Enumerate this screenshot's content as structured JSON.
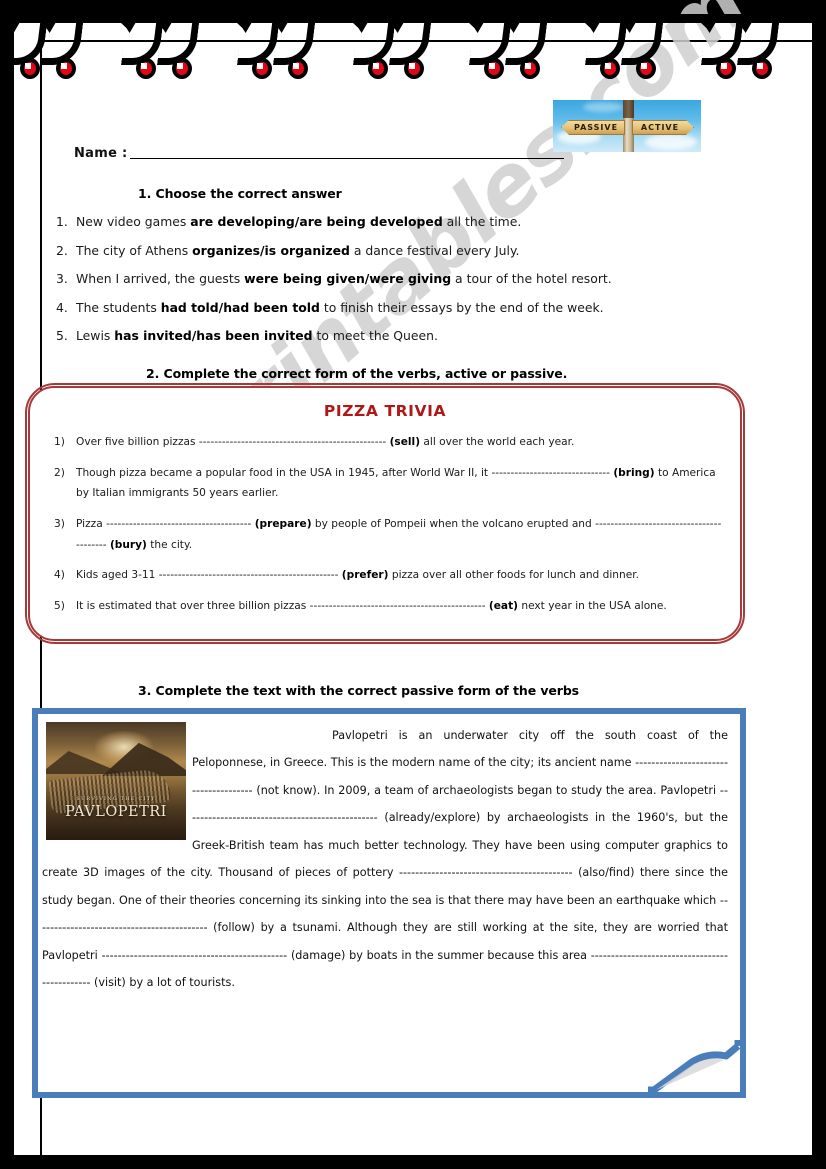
{
  "watermark": {
    "text": "ESLprintables.com"
  },
  "header": {
    "name_label": "Name :",
    "signpost": {
      "left_label": "PASSIVE",
      "right_label": "ACTIVE"
    }
  },
  "exercise1": {
    "heading": "1.   Choose the correct answer",
    "items": [
      {
        "num": "1.",
        "pre": "New video games ",
        "bold": "are developing/are being developed",
        "post": " all the time."
      },
      {
        "num": "2.",
        "pre": "The city of Athens ",
        "bold": "organizes/is organized",
        "post": " a dance festival every July."
      },
      {
        "num": "3.",
        "pre": "When I arrived, the guests ",
        "bold": "were being given/were giving",
        "post": " a tour of the hotel resort."
      },
      {
        "num": "4.",
        "pre": "The students ",
        "bold": "had told/had been told",
        "post": " to finish their essays by the end of the week."
      },
      {
        "num": "5.",
        "pre": "Lewis ",
        "bold": "has invited/has been invited",
        "post": " to meet the Queen."
      }
    ]
  },
  "exercise2": {
    "heading": "2.   Complete the correct form of the verbs, active or passive.",
    "box_title": "PIZZA TRIVIA",
    "items": [
      {
        "num": "1)",
        "pre": "Over five billion pizzas ------------------------------------------------- ",
        "bold": "(sell)",
        "post": " all over the world each year."
      },
      {
        "num": "2)",
        "pre": "Though pizza became a popular food in the USA in 1945, after World War II, it ------------------------------- ",
        "bold": "(bring)",
        "post": " to America by Italian immigrants 50 years earlier."
      },
      {
        "num": "3)",
        "pre": "Pizza -------------------------------------- ",
        "bold": "(prepare)",
        "post": " by people of Pompeii when the volcano erupted and ----------------------------------------- ",
        "bold2": "(bury)",
        "post2": " the city."
      },
      {
        "num": "4)",
        "pre": "Kids aged 3-11 ----------------------------------------------- ",
        "bold": "(prefer)",
        "post": " pizza over all other foods for lunch and dinner."
      },
      {
        "num": "5)",
        "pre": "It is estimated that over three billion pizzas ---------------------------------------------- ",
        "bold": "(eat)",
        "post": " next year in the USA alone."
      }
    ]
  },
  "exercise3": {
    "heading": "3. Complete the text with the correct passive form of the verbs",
    "image_caption_small": "SURVIVING THE CITY",
    "image_caption_main": "PAVLOPETRI",
    "text": "Pavlopetri is an underwater city off the south coast of the Peloponnese, in Greece. This is the modern name of the city; its ancient name -------------------------------------- (not know). In 2009, a team of archaeologists began to study the area. Pavlopetri ------------------------------------------------ (already/explore) by archaeologists in the 1960's, but the Greek-British team has much better technology. They have been using computer graphics to create 3D images of the city. Thousand of pieces of pottery ------------------------------------------- (also/find) there since the study began. One of their theories concerning its sinking into the sea is that there may have been an earthquake which ------------------------------------------- (follow) by a tsunami. Although they are still working at the site, they are worried that Pavlopetri ---------------------------------------------- (damage) by boats in the summer because this area ---------------------------------------------- (visit) by a lot of tourists."
  },
  "colors": {
    "frame_black": "#000000",
    "pizza_border_red": "#a63a3a",
    "pizza_title_red": "#b01818",
    "blue_border": "#4a7ebb",
    "spiral_bead_red": "#e30613",
    "watermark_gray": "#cfcfcf"
  }
}
